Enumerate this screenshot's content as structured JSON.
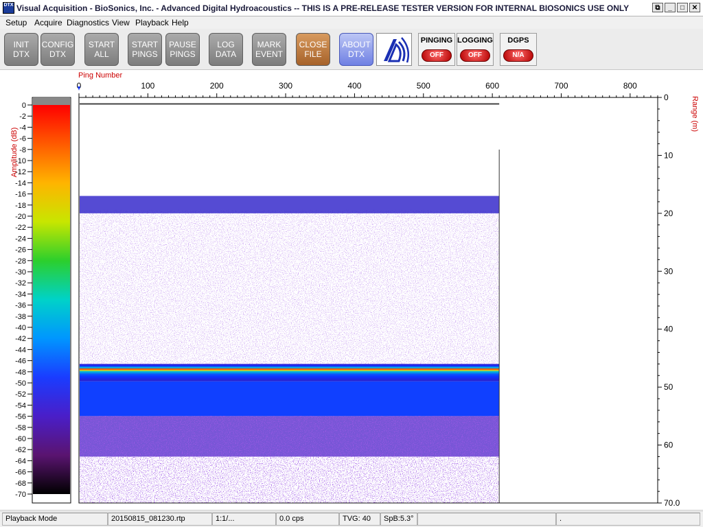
{
  "window": {
    "icon_text": "DTX",
    "title": "Visual Acquisition  -  BioSonics, Inc.  -  Advanced Digital Hydroacoustics  -- THIS IS A PRE-RELEASE TESTER VERSION FOR INTERNAL BIOSONICS USE ONLY",
    "controls": [
      "restore-icon",
      "minimize-icon",
      "maximize-icon",
      "close-icon"
    ]
  },
  "menu": [
    {
      "label": "Setup",
      "x": 8
    },
    {
      "label": "Acquire",
      "x": 50
    },
    {
      "label": "Diagnostics",
      "x": 97
    },
    {
      "label": "View",
      "x": 163
    },
    {
      "label": "Playback",
      "x": 197
    },
    {
      "label": "Help",
      "x": 250
    }
  ],
  "toolbar": {
    "buttons": [
      {
        "id": "init-dtx",
        "label": "INIT\nDTX",
        "style": "gray"
      },
      {
        "id": "config-dtx",
        "label": "CONFIG\nDTX",
        "style": "gray"
      },
      {
        "id": "start-all",
        "label": "START\nALL",
        "style": "gray"
      },
      {
        "id": "start-pings",
        "label": "START\nPINGS",
        "style": "gray"
      },
      {
        "id": "pause-pings",
        "label": "PAUSE\nPINGS",
        "style": "gray"
      },
      {
        "id": "log-data",
        "label": "LOG\nDATA",
        "style": "gray"
      },
      {
        "id": "mark-event",
        "label": "MARK\nEVENT",
        "style": "gray"
      },
      {
        "id": "close-file",
        "label": "CLOSE\nFILE",
        "style": "orange"
      },
      {
        "id": "about-dtx",
        "label": "ABOUT\nDTX",
        "style": "blue"
      }
    ],
    "indicators": [
      {
        "id": "pinging",
        "label": "PINGING",
        "state": "OFF"
      },
      {
        "id": "logging",
        "label": "LOGGING",
        "state": "OFF"
      },
      {
        "id": "dgps",
        "label": "DGPS",
        "state": "N/A"
      }
    ],
    "logo_icon": "biosonics-logo-icon"
  },
  "chart_data": {
    "type": "heatmap",
    "title": "",
    "xlabel": "Ping Number",
    "ylabel": "Range (m)",
    "colorbar_label": "Amplitude (dB)",
    "x_ticks": [
      0,
      100,
      200,
      300,
      400,
      500,
      600,
      700,
      800
    ],
    "xlim": [
      0,
      840
    ],
    "y_ticks": [
      "0",
      "10",
      "20",
      "30",
      "40",
      "50",
      "60",
      "70.0"
    ],
    "ylim": [
      0,
      70
    ],
    "y_inverted": true,
    "colorbar_ticks": [
      0,
      -2,
      -4,
      -6,
      -8,
      -10,
      -12,
      -14,
      -16,
      -18,
      -20,
      -22,
      -24,
      -26,
      -28,
      -30,
      -32,
      -34,
      -36,
      -38,
      -40,
      -42,
      -44,
      -46,
      -48,
      -50,
      -52,
      -54,
      -56,
      -58,
      -60,
      -62,
      -64,
      -66,
      -68,
      -70
    ],
    "colorbar_range": [
      -70,
      0
    ],
    "data_extent_pings": [
      0,
      610
    ],
    "features": [
      {
        "name": "surface-layer",
        "range_m": [
          17,
          20
        ],
        "amplitude_db": -55
      },
      {
        "name": "bottom-echo",
        "range_m": [
          46,
          49
        ],
        "amplitude_db": -20
      },
      {
        "name": "sub-bottom",
        "range_m": [
          49,
          55
        ],
        "amplitude_db": -45
      }
    ]
  },
  "status": [
    {
      "text": "Playback Mode",
      "x": 3,
      "w": 154
    },
    {
      "text": "20150815_081230.rtp",
      "x": 157,
      "w": 152
    },
    {
      "text": "1:1/...",
      "x": 309,
      "w": 93
    },
    {
      "text": "0.0 cps",
      "x": 402,
      "w": 92
    },
    {
      "text": "TVG: 40",
      "x": 494,
      "w": 60
    },
    {
      "text": "SpB:5.3°",
      "x": 554,
      "w": 54
    },
    {
      "text": "",
      "x": 608,
      "w": 202
    },
    {
      "text": ".",
      "x": 810,
      "w": 210
    }
  ]
}
